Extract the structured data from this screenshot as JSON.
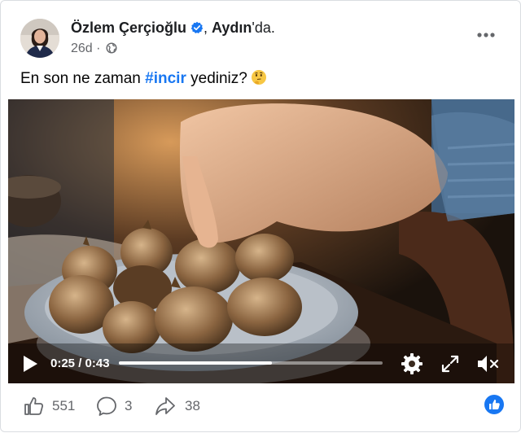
{
  "post": {
    "author": "Özlem Çerçioğlu",
    "location_separator": ", ",
    "location": "Aydın",
    "location_suffix": "'da.",
    "time": "26d",
    "dot": " · ",
    "text_before": "En son ne zaman ",
    "hashtag": "#incir",
    "text_after": " yediniz?",
    "emoji": "thinking-face-emoji"
  },
  "video": {
    "current_time": "0:25",
    "separator": " / ",
    "duration": "0:43",
    "progress_fraction": 0.58,
    "icons": [
      "play-icon",
      "gear-icon",
      "fullscreen-icon",
      "muted-speaker-icon"
    ]
  },
  "stats": {
    "likes": "551",
    "comments": "3",
    "shares": "38"
  },
  "colors": {
    "accent": "#1877f2",
    "muted": "#65676b",
    "text": "#050505"
  }
}
